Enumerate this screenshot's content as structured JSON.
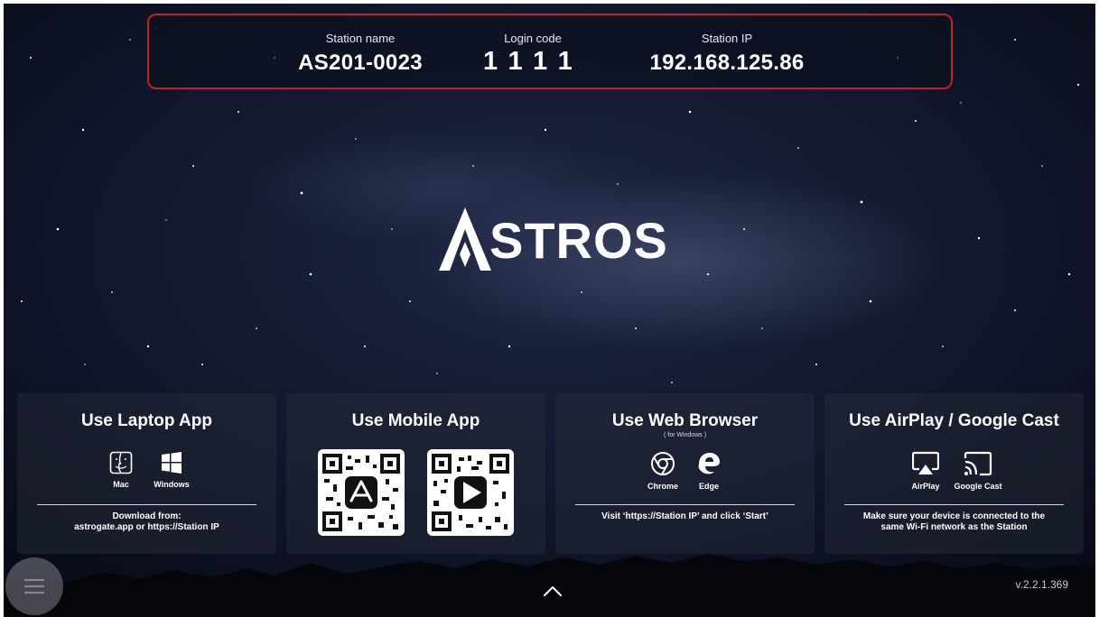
{
  "station": {
    "name_label": "Station name",
    "name_value": "AS201-0023",
    "code_label": "Login code",
    "code_value": "1111",
    "ip_label": "Station IP",
    "ip_value": "192.168.125.86"
  },
  "logo": {
    "text": "STROS",
    "brand": "ASTROS"
  },
  "panels": [
    {
      "title": "Use Laptop App",
      "icons": [
        {
          "icon": "mac-finder-icon",
          "label": "Mac"
        },
        {
          "icon": "windows-icon",
          "label": "Windows"
        }
      ],
      "note_line1": "Download from:",
      "note_line2": "astrogate.app  or  https://Station IP"
    },
    {
      "title": "Use Mobile App",
      "qr_codes": [
        {
          "icon": "app-store-qr-icon"
        },
        {
          "icon": "google-play-qr-icon"
        }
      ]
    },
    {
      "title": "Use Web Browser",
      "subtitle": "( for Windows )",
      "icons": [
        {
          "icon": "chrome-icon",
          "label": "Chrome"
        },
        {
          "icon": "edge-icon",
          "label": "Edge"
        }
      ],
      "note_line1": "Visit ‘https://Station IP’ and click ‘Start’"
    },
    {
      "title": "Use AirPlay / Google Cast",
      "icons": [
        {
          "icon": "airplay-icon",
          "label": "AirPlay"
        },
        {
          "icon": "google-cast-icon",
          "label": "Google Cast"
        }
      ],
      "note_line1": "Make sure your device is connected to the",
      "note_line2": "same Wi-Fi network as the Station"
    }
  ],
  "footer": {
    "menu_icon": "hamburger-menu-icon",
    "chevron_icon": "chevron-up-icon",
    "version": "v.2.2.1.369"
  },
  "colors": {
    "accent_border": "#c0202c",
    "background": "#11172c",
    "text": "#ffffff"
  }
}
